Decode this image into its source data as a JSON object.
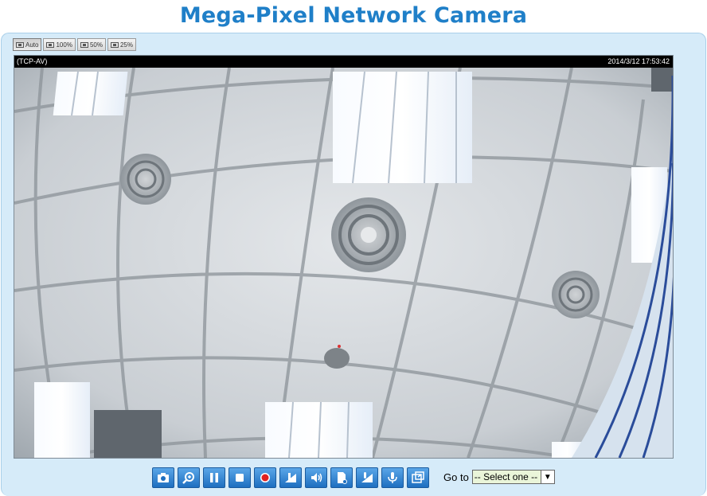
{
  "page": {
    "title": "Mega-Pixel Network Camera"
  },
  "zoom": {
    "options": [
      {
        "label": "Auto",
        "active": true
      },
      {
        "label": "100%",
        "active": false
      },
      {
        "label": "50%",
        "active": false
      },
      {
        "label": "25%",
        "active": false
      }
    ]
  },
  "viewer": {
    "protocol": "(TCP-AV)",
    "timestamp": "2014/3/12 17:53:42"
  },
  "controls": [
    {
      "name": "snapshot-button",
      "icon": "camera-icon"
    },
    {
      "name": "digital-zoom-button",
      "icon": "zoom-in-icon"
    },
    {
      "name": "pause-button",
      "icon": "pause-icon"
    },
    {
      "name": "stop-button",
      "icon": "stop-icon"
    },
    {
      "name": "record-button",
      "icon": "record-icon"
    },
    {
      "name": "volume-button",
      "icon": "volume-slider-icon"
    },
    {
      "name": "mute-button",
      "icon": "speaker-icon"
    },
    {
      "name": "storage-button",
      "icon": "document-icon"
    },
    {
      "name": "mic-volume-button",
      "icon": "mic-slider-icon"
    },
    {
      "name": "talk-button",
      "icon": "microphone-icon"
    },
    {
      "name": "fullscreen-button",
      "icon": "fullscreen-icon"
    }
  ],
  "goto": {
    "label": "Go to",
    "selected": "-- Select one --"
  },
  "colors": {
    "title": "#1f7fc8",
    "panel": "#d6ebf9",
    "button": "#2a7bcc",
    "select_bg": "#eaf5d9"
  }
}
